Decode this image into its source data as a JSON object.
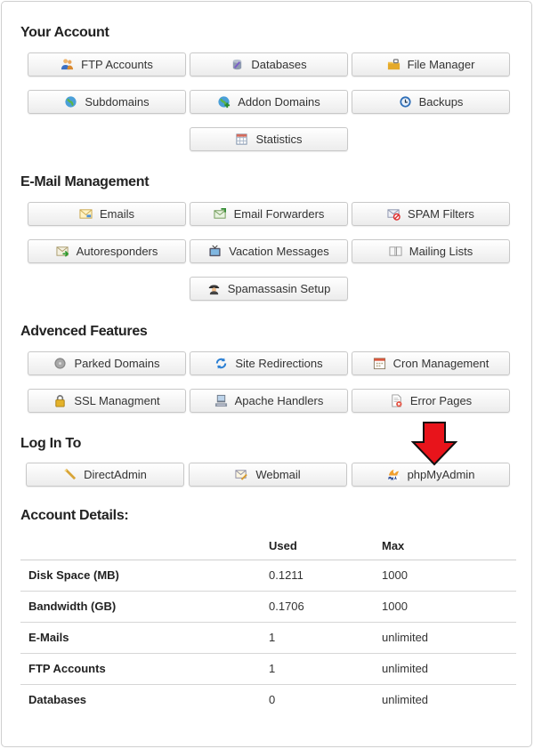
{
  "sections": {
    "your_account": "Your Account",
    "email_management": "E-Mail Management",
    "advanced_features": "Advenced Features",
    "log_in_to": "Log In To",
    "account_details": "Account Details:"
  },
  "your_account": {
    "ftp_accounts": "FTP Accounts",
    "databases": "Databases",
    "file_manager": "File Manager",
    "subdomains": "Subdomains",
    "addon_domains": "Addon Domains",
    "backups": "Backups",
    "statistics": "Statistics"
  },
  "email": {
    "emails": "Emails",
    "email_forwarders": "Email Forwarders",
    "spam_filters": "SPAM Filters",
    "autoresponders": "Autoresponders",
    "vacation_messages": "Vacation Messages",
    "mailing_lists": "Mailing Lists",
    "spamassasin_setup": "Spamassasin Setup"
  },
  "advanced": {
    "parked_domains": "Parked Domains",
    "site_redirections": "Site Redirections",
    "cron_management": "Cron Management",
    "ssl_management": "SSL Managment",
    "apache_handlers": "Apache Handlers",
    "error_pages": "Error Pages"
  },
  "login": {
    "directadmin": "DirectAdmin",
    "webmail": "Webmail",
    "phpmyadmin": "phpMyAdmin"
  },
  "details": {
    "headers": {
      "label": "",
      "used": "Used",
      "max": "Max"
    },
    "rows": [
      {
        "label": "Disk Space (MB)",
        "used": "0.1211",
        "max": "1000"
      },
      {
        "label": "Bandwidth (GB)",
        "used": "0.1706",
        "max": "1000"
      },
      {
        "label": "E-Mails",
        "used": "1",
        "max": "unlimited"
      },
      {
        "label": "FTP Accounts",
        "used": "1",
        "max": "unlimited"
      },
      {
        "label": "Databases",
        "used": "0",
        "max": "unlimited"
      }
    ]
  },
  "colors": {
    "arrow": "#e8141b",
    "border": "#c8c8c8"
  },
  "icons": {
    "ftp": "users-icon",
    "databases": "database-icon",
    "file_manager": "folder-lock-icon",
    "subdomains": "globe-icon",
    "addon_domains": "globe-plus-icon",
    "backups": "clock-icon",
    "statistics": "chart-table-icon",
    "emails": "envelope-icon",
    "forwarders": "envelope-forward-icon",
    "spam": "envelope-block-icon",
    "autoresponders": "envelope-reply-icon",
    "vacation": "tv-icon",
    "mailing_lists": "book-icon",
    "spamassasin": "spy-icon",
    "parked": "disc-icon",
    "redirections": "refresh-icon",
    "cron": "calendar-icon",
    "ssl": "lock-icon",
    "apache": "server-icon",
    "error_pages": "page-error-icon",
    "directadmin": "wand-icon",
    "webmail": "envelope-pen-icon",
    "phpmyadmin": "pma-logo-icon"
  }
}
